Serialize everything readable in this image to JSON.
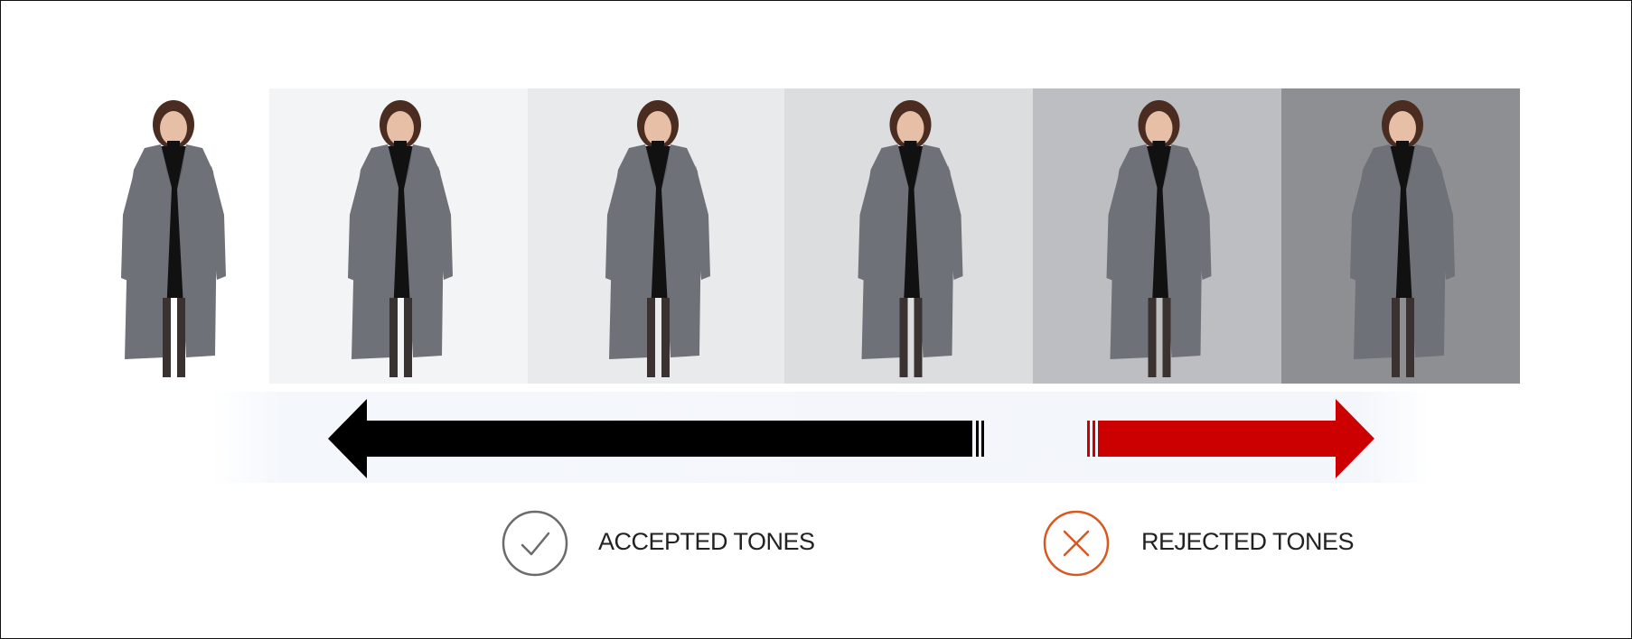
{
  "legend": {
    "accepted_label": "ACCEPTED TONES",
    "rejected_label": "REJECTED TONES",
    "accepted_icon": "check-circle-icon",
    "rejected_icon": "x-circle-icon"
  },
  "colors": {
    "accepted_arrow": "#000000",
    "rejected_arrow": "#cc0000",
    "accepted_icon": "#6b6b6b",
    "rejected_icon": "#d9581e",
    "coat": "#6e7178",
    "dress": "#111111",
    "hair": "#4a2d20",
    "skin": "#e6bfa6"
  },
  "backgrounds": [
    "#ffffff",
    "#f3f4f5",
    "#e9eaeb",
    "#dcdddf",
    "#bdbec1",
    "#8e8f93"
  ]
}
